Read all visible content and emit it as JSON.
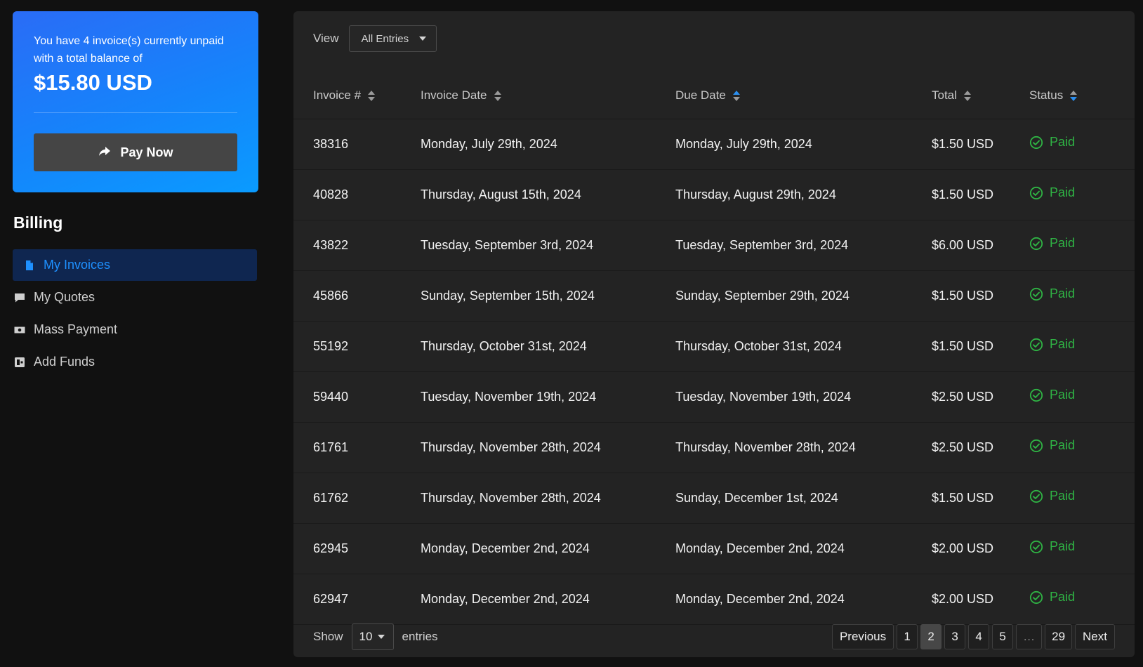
{
  "summary": {
    "message": "You have 4 invoice(s) currently unpaid with a total balance of",
    "amount": "$15.80 USD",
    "pay_now_label": "Pay Now"
  },
  "sidebar": {
    "title": "Billing",
    "items": [
      {
        "label": "My Invoices",
        "icon": "file-icon",
        "active": true
      },
      {
        "label": "My Quotes",
        "icon": "comment-icon",
        "active": false
      },
      {
        "label": "Mass Payment",
        "icon": "money-icon",
        "active": false
      },
      {
        "label": "Add Funds",
        "icon": "wallet-icon",
        "active": false
      }
    ]
  },
  "toolbar": {
    "view_label": "View",
    "view_value": "All Entries"
  },
  "table": {
    "headers": [
      "Invoice #",
      "Invoice Date",
      "Due Date",
      "Total",
      "Status"
    ],
    "rows": [
      {
        "id": "38316",
        "invoice_date": "Monday, July 29th, 2024",
        "due_date": "Monday, July 29th, 2024",
        "total": "$1.50 USD",
        "status": "Paid"
      },
      {
        "id": "40828",
        "invoice_date": "Thursday, August 15th, 2024",
        "due_date": "Thursday, August 29th, 2024",
        "total": "$1.50 USD",
        "status": "Paid"
      },
      {
        "id": "43822",
        "invoice_date": "Tuesday, September 3rd, 2024",
        "due_date": "Tuesday, September 3rd, 2024",
        "total": "$6.00 USD",
        "status": "Paid"
      },
      {
        "id": "45866",
        "invoice_date": "Sunday, September 15th, 2024",
        "due_date": "Sunday, September 29th, 2024",
        "total": "$1.50 USD",
        "status": "Paid"
      },
      {
        "id": "55192",
        "invoice_date": "Thursday, October 31st, 2024",
        "due_date": "Thursday, October 31st, 2024",
        "total": "$1.50 USD",
        "status": "Paid"
      },
      {
        "id": "59440",
        "invoice_date": "Tuesday, November 19th, 2024",
        "due_date": "Tuesday, November 19th, 2024",
        "total": "$2.50 USD",
        "status": "Paid"
      },
      {
        "id": "61761",
        "invoice_date": "Thursday, November 28th, 2024",
        "due_date": "Thursday, November 28th, 2024",
        "total": "$2.50 USD",
        "status": "Paid"
      },
      {
        "id": "61762",
        "invoice_date": "Thursday, November 28th, 2024",
        "due_date": "Sunday, December 1st, 2024",
        "total": "$1.50 USD",
        "status": "Paid"
      },
      {
        "id": "62945",
        "invoice_date": "Monday, December 2nd, 2024",
        "due_date": "Monday, December 2nd, 2024",
        "total": "$2.00 USD",
        "status": "Paid"
      },
      {
        "id": "62947",
        "invoice_date": "Monday, December 2nd, 2024",
        "due_date": "Monday, December 2nd, 2024",
        "total": "$2.00 USD",
        "status": "Paid"
      }
    ]
  },
  "footer": {
    "show_label": "Show",
    "page_length": "10",
    "entries_label": "entries",
    "previous_label": "Previous",
    "next_label": "Next",
    "pages": [
      "1",
      "2",
      "3",
      "4",
      "5",
      "…",
      "29"
    ],
    "current_page": "2"
  },
  "colors": {
    "accent": "#1e90ff",
    "paid": "#2fb344",
    "panel": "#232323",
    "background": "#111111"
  }
}
